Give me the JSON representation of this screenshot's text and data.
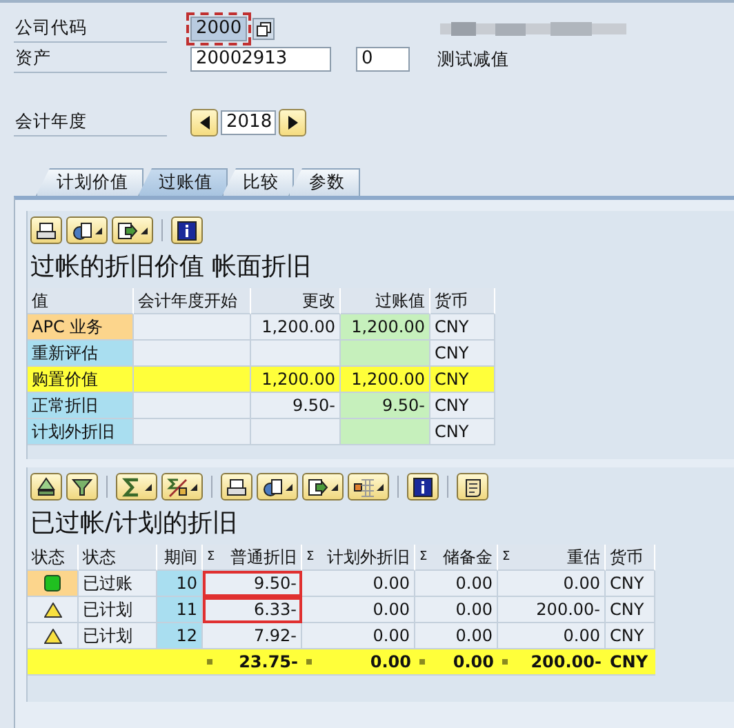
{
  "header": {
    "company_code": {
      "label": "公司代码",
      "value": "2000",
      "focused": true
    },
    "asset": {
      "label": "资产",
      "value": "20002913",
      "sub_number": "0",
      "description": "测试减值"
    },
    "fiscal_year": {
      "label": "会计年度",
      "value": "2018"
    }
  },
  "tabs": [
    {
      "label": "计划价值",
      "selected": false
    },
    {
      "label": "过账值",
      "selected": true
    },
    {
      "label": "比较",
      "selected": false
    },
    {
      "label": "参数",
      "selected": false
    }
  ],
  "posted_values": {
    "title": "过帐的折旧价值 帐面折旧",
    "columns": [
      "值",
      "会计年度开始",
      "更改",
      "过账值",
      "货币"
    ],
    "rows": [
      {
        "value": "APC 业务",
        "change": "1,200.00",
        "posted": "1,200.00",
        "currency": "CNY",
        "selected": true,
        "kind": "normal"
      },
      {
        "value": "重新评估",
        "currency": "CNY",
        "selected": false,
        "kind": "normal"
      },
      {
        "value": "购置价值",
        "change": "1,200.00",
        "posted": "1,200.00",
        "currency": "CNY",
        "selected": false,
        "kind": "total"
      },
      {
        "value": "正常折旧",
        "change": "9.50-",
        "posted": "9.50-",
        "currency": "CNY",
        "selected": false,
        "kind": "normal"
      },
      {
        "value": "计划外折旧",
        "currency": "CNY",
        "selected": false,
        "kind": "normal"
      }
    ]
  },
  "depreciation": {
    "title": "已过帐/计划的折旧",
    "columns": [
      {
        "label": "状态"
      },
      {
        "label": "状态"
      },
      {
        "label": "期间"
      },
      {
        "label": "普通折旧",
        "sigma": "Σ"
      },
      {
        "label": "计划外折旧",
        "sigma": "Σ"
      },
      {
        "label": "储备金",
        "sigma": "Σ"
      },
      {
        "label": "重估",
        "sigma": "Σ"
      },
      {
        "label": "货币"
      }
    ],
    "rows": [
      {
        "kind": "posted",
        "status": "已过账",
        "period": "10",
        "ordinary": "9.50-",
        "unplanned": "0.00",
        "reserve": "0.00",
        "revaluation": "0.00",
        "currency": "CNY",
        "selected": true,
        "marked": true
      },
      {
        "kind": "planned",
        "status": "已计划",
        "period": "11",
        "ordinary": "6.33-",
        "unplanned": "0.00",
        "reserve": "0.00",
        "revaluation": "200.00-",
        "currency": "CNY",
        "selected": false,
        "marked": true
      },
      {
        "kind": "planned",
        "status": "已计划",
        "period": "12",
        "ordinary": "7.92-",
        "unplanned": "0.00",
        "reserve": "0.00",
        "revaluation": "0.00",
        "currency": "CNY",
        "selected": false,
        "marked": false
      }
    ],
    "totals": {
      "ordinary": "23.75-",
      "unplanned": "0.00",
      "reserve": "0.00",
      "revaluation": "200.00-",
      "currency": "CNY"
    }
  }
}
